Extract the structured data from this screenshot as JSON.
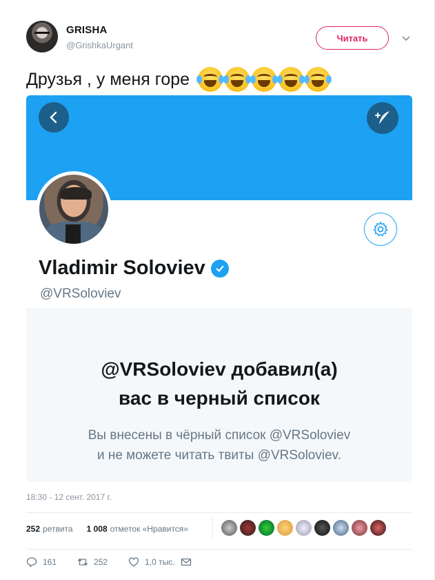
{
  "author": {
    "name": "GRISHA",
    "handle": "@GrishkaUrgant",
    "follow_label": "Читать"
  },
  "tweet": {
    "text": "Друзья , у меня горе"
  },
  "screenshot": {
    "profile_name": "Vladimir Soloviev",
    "profile_handle": "@VRSoloviev",
    "blocked_title_line1": "@VRSoloviev добавил(а)",
    "blocked_title_line2": "вас в черный список",
    "blocked_desc_line1": "Вы внесены в чёрный список @VRSoloviev",
    "blocked_desc_line2": "и не можете читать твиты @VRSoloviev."
  },
  "meta": {
    "timestamp": "18:30 - 12 сент. 2017 г.",
    "retweets_count": "252",
    "retweets_label": "ретвита",
    "likes_count": "1 008",
    "likes_label": "отметок «Нравится»"
  },
  "actions": {
    "reply_count": "161",
    "retweet_count": "252",
    "like_count": "1,0 тыс."
  },
  "colors": {
    "accent": "#1da1f2",
    "follow": "#e0245e"
  }
}
